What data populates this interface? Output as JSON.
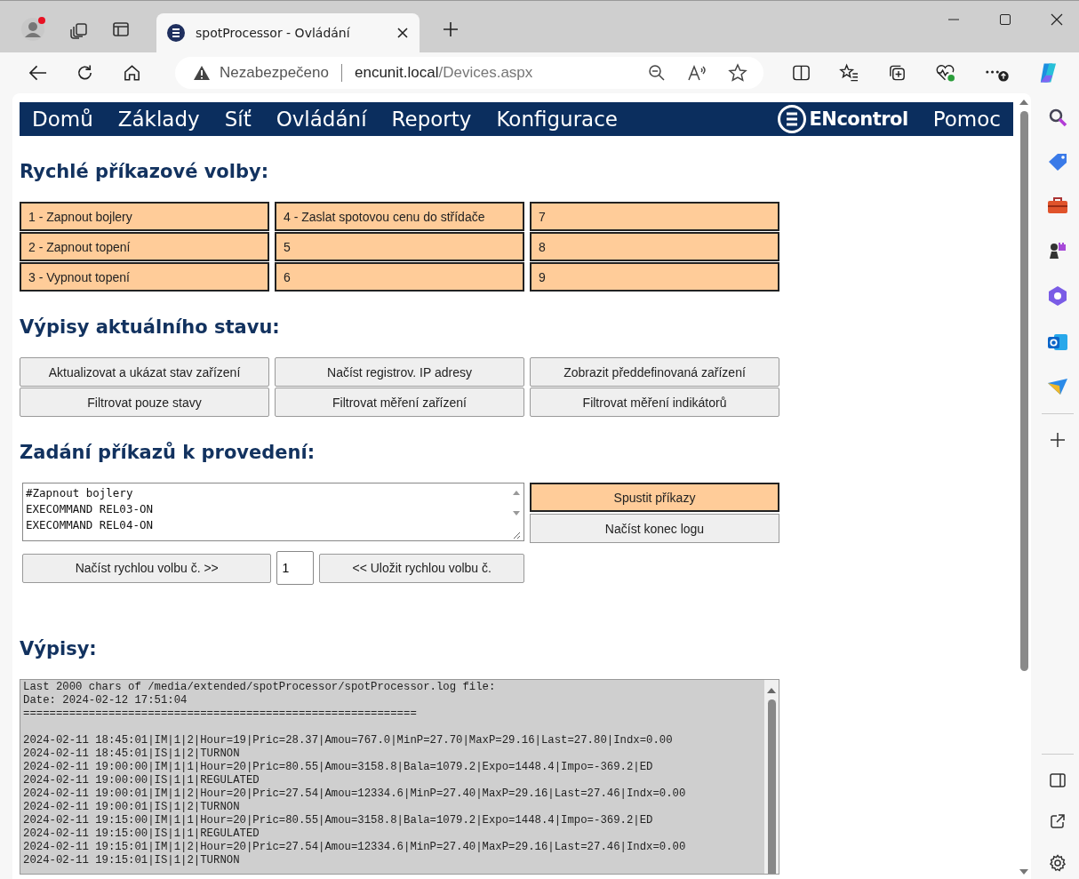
{
  "browser": {
    "tab_title": "spotProcessor - Ovládání",
    "address": {
      "warning": "Nezabezpečeno",
      "host": "encunit.local",
      "path": "/Devices.aspx"
    }
  },
  "nav": {
    "items": [
      "Domů",
      "Základy",
      "Síť",
      "Ovládání",
      "Reporty",
      "Konfigurace"
    ],
    "logo": "ENcontrol",
    "help": "Pomoc"
  },
  "quick": {
    "heading": "Rychlé příkazové volby:",
    "buttons": [
      "1 - Zapnout bojlery",
      "4 - Zaslat spotovou cenu do střídače",
      "7",
      "2 - Zapnout topení",
      "5",
      "8",
      "3 - Vypnout topení",
      "6",
      "9"
    ]
  },
  "status": {
    "heading": "Výpisy aktuálního stavu:",
    "buttons": [
      "Aktualizovat a ukázat stav zařízení",
      "Načíst registrov. IP adresy",
      "Zobrazit předdefinovaná zařízení",
      "Filtrovat pouze stavy",
      "Filtrovat měření zařízení",
      "Filtrovat měření indikátorů"
    ]
  },
  "commands": {
    "heading": "Zadání příkazů k provedení:",
    "lines": [
      "#Zapnout bojlery",
      "EXECOMMAND REL03-ON",
      "EXECOMMAND REL04-ON"
    ],
    "actions": [
      {
        "label": "Spustit příkazy",
        "kind": "primary"
      },
      {
        "label": "Načíst konec logu",
        "kind": "normal"
      }
    ],
    "load_button": "Načíst rychlou volbu č. >>",
    "slot_value": "1",
    "save_button": "<< Uložit rychlou volbu č."
  },
  "output": {
    "heading": "Výpisy:",
    "header": [
      "Last 2000 chars of /media/extended/spotProcessor/spotProcessor.log file:",
      "Date: 2024-02-12 17:51:04",
      "============================================================"
    ],
    "entries": [
      "2024-02-11 18:45:01|IM|1|2|Hour=19|Pric=28.37|Amou=767.0|MinP=27.70|MaxP=29.16|Last=27.80|Indx=0.00",
      "2024-02-11 18:45:01|IS|1|2|TURNON",
      "2024-02-11 19:00:00|IM|1|1|Hour=20|Pric=80.55|Amou=3158.8|Bala=1079.2|Expo=1448.4|Impo=-369.2|ED",
      "2024-02-11 19:00:00|IS|1|1|REGULATED",
      "2024-02-11 19:00:01|IM|1|2|Hour=20|Pric=27.54|Amou=12334.6|MinP=27.40|MaxP=29.16|Last=27.46|Indx=0.00",
      "2024-02-11 19:00:01|IS|1|2|TURNON",
      "2024-02-11 19:15:00|IM|1|1|Hour=20|Pric=80.55|Amou=3158.8|Bala=1079.2|Expo=1448.4|Impo=-369.2|ED",
      "2024-02-11 19:15:00|IS|1|1|REGULATED",
      "2024-02-11 19:15:01|IM|1|2|Hour=20|Pric=27.54|Amou=12334.6|MinP=27.40|MaxP=29.16|Last=27.46|Indx=0.00",
      "2024-02-11 19:15:01|IS|1|2|TURNON"
    ]
  }
}
